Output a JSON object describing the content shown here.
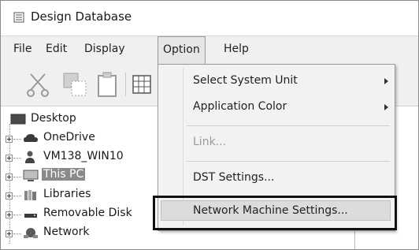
{
  "window": {
    "title": "Design Database"
  },
  "menubar": {
    "items": [
      "File",
      "Edit",
      "Display",
      "Option",
      "Help"
    ]
  },
  "toolbar": {
    "icons": [
      "cut-icon",
      "copy-icon",
      "paste-icon",
      "grid-view-icon"
    ]
  },
  "tree": {
    "root": "Desktop",
    "items": [
      {
        "label": "OneDrive",
        "icon": "cloud-icon"
      },
      {
        "label": "VM138_WIN10",
        "icon": "user-icon"
      },
      {
        "label": "This PC",
        "icon": "computer-icon",
        "selected": true
      },
      {
        "label": "Libraries",
        "icon": "library-icon"
      },
      {
        "label": "Removable Disk",
        "icon": "drive-icon"
      },
      {
        "label": "Network",
        "icon": "network-icon"
      }
    ]
  },
  "dropdown": {
    "items": [
      {
        "label": "Select System Unit",
        "submenu": true
      },
      {
        "label": "Application Color",
        "submenu": true
      },
      {
        "label": "Link...",
        "disabled": true
      },
      {
        "label": "DST Settings..."
      },
      {
        "label": "Network Machine Settings...",
        "highlighted": true
      }
    ]
  },
  "colors": {
    "selection": "#8a8a8a",
    "menu_bg": "#f2f2f2",
    "callout": "#111111"
  }
}
